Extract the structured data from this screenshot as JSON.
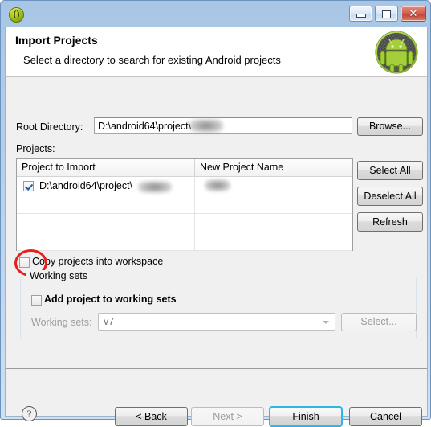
{
  "window": {
    "icon": "eclipse-window-icon",
    "controls": {
      "minimize": "–",
      "maximize": "□",
      "close": "✕"
    }
  },
  "header": {
    "title": "Import Projects",
    "subtitle": "Select a directory to search for existing Android projects",
    "logo": "android-robot-logo"
  },
  "form": {
    "root_directory_label": "Root Directory:",
    "root_directory_value": "D:\\android64\\project\\",
    "root_directory_placeholder": "",
    "browse_label": "Browse...",
    "projects_label": "Projects:"
  },
  "table": {
    "columns": [
      "Project to Import",
      "New Project Name"
    ],
    "rows": [
      {
        "checked": true,
        "project_to_import": "D:\\android64\\project\\",
        "new_project_name": ""
      }
    ],
    "empty_rows": 3
  },
  "side_buttons": {
    "select_all": "Select All",
    "deselect_all": "Deselect All",
    "refresh": "Refresh"
  },
  "options": {
    "copy_projects_label": "Copy projects into workspace",
    "copy_projects_checked": false
  },
  "working_sets": {
    "group_title": "Working sets",
    "add_project_label": "Add project to working sets",
    "add_project_checked": false,
    "working_sets_label": "Working sets:",
    "working_sets_value": "v7",
    "select_label": "Select..."
  },
  "footer": {
    "help_label": "?",
    "back_label": "< Back",
    "next_label": "Next >",
    "finish_label": "Finish",
    "cancel_label": "Cancel",
    "next_disabled": true,
    "finish_is_default": true
  },
  "annotation": {
    "type": "red-ellipse-highlight",
    "target": "copy-projects-into-workspace-checkbox",
    "color": "#e8201c"
  },
  "colors": {
    "titlebar_top": "#8cb2d9",
    "titlebar_bottom": "#cfe0f2",
    "dialog_background": "#f0f0f0",
    "header_background": "#ffffff",
    "focus_border": "#2fb6e9",
    "annotation_red": "#e8201c"
  }
}
